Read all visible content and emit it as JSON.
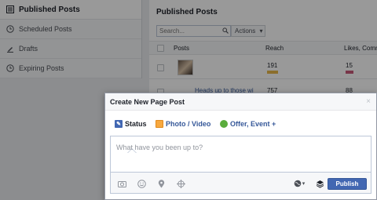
{
  "sidebar": {
    "items": [
      {
        "label": "Published Posts",
        "icon": "list-icon"
      },
      {
        "label": "Scheduled Posts",
        "icon": "clock-icon"
      },
      {
        "label": "Drafts",
        "icon": "pencil-icon"
      },
      {
        "label": "Expiring Posts",
        "icon": "clock-icon"
      }
    ]
  },
  "main": {
    "title": "Published Posts",
    "search_placeholder": "Search...",
    "actions_label": "Actions",
    "columns": [
      "Posts",
      "Reach",
      "Likes, Comm"
    ],
    "rows": [
      {
        "text": "",
        "reach": "191",
        "likes": "15"
      },
      {
        "text": "Heads up to those wi",
        "reach": "757",
        "likes": "88"
      }
    ]
  },
  "dialog": {
    "title": "Create New Page Post",
    "close": "×",
    "tabs": [
      {
        "label": "Status",
        "icon": "pencil-icon"
      },
      {
        "label": "Photo / Video",
        "icon": "photo-icon"
      },
      {
        "label": "Offer, Event +",
        "icon": "gear-icon"
      }
    ],
    "placeholder": "What have you been up to?",
    "publish_label": "Publish"
  },
  "colors": {
    "brand_blue": "#4267b2",
    "link_blue": "#365899",
    "reach_bar": "#e8b84a",
    "likes_bar": "#c95b7a"
  }
}
